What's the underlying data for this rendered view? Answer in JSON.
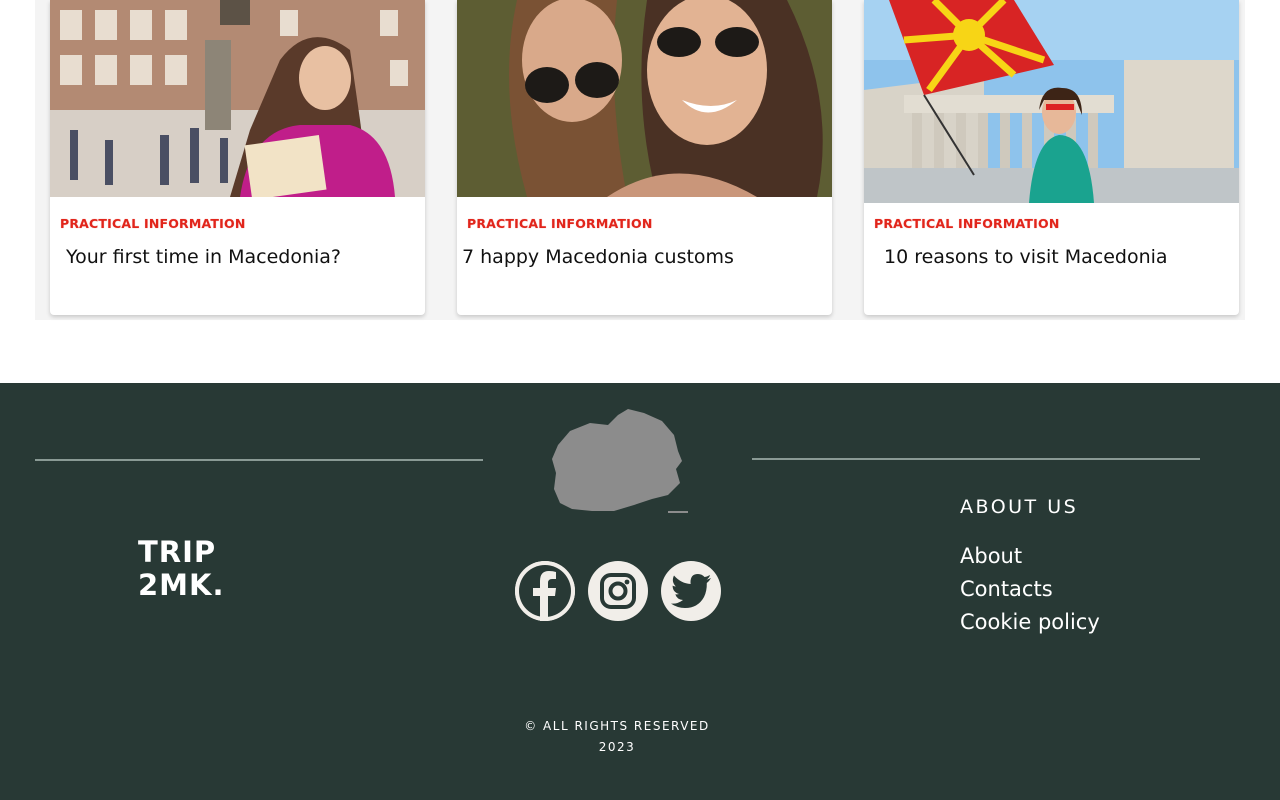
{
  "cards": [
    {
      "category": "PRACTICAL INFORMATION",
      "title": "Your first time in Macedonia?"
    },
    {
      "category": "PRACTICAL INFORMATION",
      "title": "7 happy Macedonia customs"
    },
    {
      "category": "PRACTICAL INFORMATION",
      "title": "10 reasons to visit Macedonia"
    }
  ],
  "footer": {
    "logo_line1": "TRIP",
    "logo_line2": "2MK.",
    "social": [
      "facebook-icon",
      "instagram-icon",
      "twitter-icon"
    ],
    "about_heading": "ABOUT US",
    "links": [
      "About",
      "Contacts",
      "Cookie policy"
    ],
    "copyright_line1": "© ALL RIGHTS RESERVED",
    "copyright_line2": "2023"
  },
  "colors": {
    "footer_bg": "#283935",
    "category_red": "#e1251b",
    "social_bg": "#f1eee9"
  }
}
